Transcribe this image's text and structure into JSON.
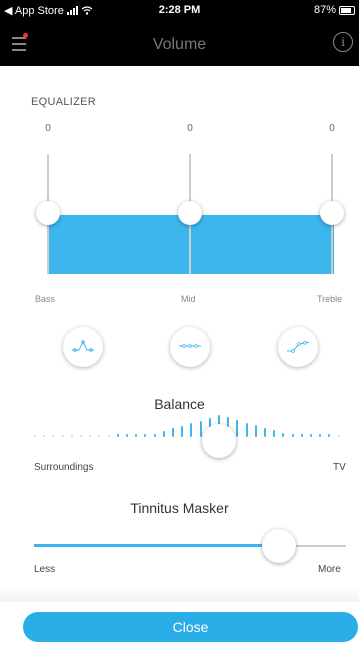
{
  "status_bar": {
    "back_app": "◀ App Store",
    "time": "2:28 PM",
    "battery": "87%"
  },
  "nav": {
    "title": "Volume",
    "menu_icon": "menu-icon",
    "info_icon": "info-icon",
    "info_glyph": "i"
  },
  "equalizer": {
    "label": "EQUALIZER",
    "bands": [
      {
        "name": "Bass",
        "value": "0"
      },
      {
        "name": "Mid",
        "value": "0"
      },
      {
        "name": "Treble",
        "value": "0"
      }
    ],
    "fill_color": "#3db6ee",
    "presets": [
      "bass-boost-curve-icon",
      "flat-curve-icon",
      "treble-boost-curve-icon"
    ]
  },
  "balance": {
    "title": "Balance",
    "left_label": "Surroundings",
    "right_label": "TV",
    "position": 0.5
  },
  "tinnitus": {
    "title": "Tinnitus Masker",
    "left_label": "Less",
    "right_label": "More",
    "level": 0.79
  },
  "close_button": {
    "label": "Close",
    "color": "#2aaee8"
  }
}
